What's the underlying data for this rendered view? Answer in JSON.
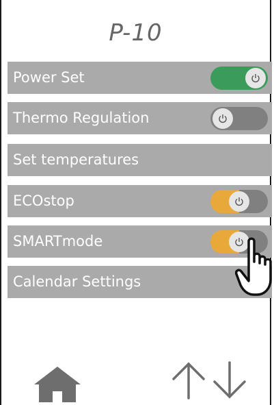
{
  "header": {
    "title": "P-10"
  },
  "menu": {
    "items": [
      {
        "label": "Power Set",
        "toggle": "on",
        "toggle_color": "#3a9b5a"
      },
      {
        "label": "Thermo Regulation",
        "toggle": "off"
      },
      {
        "label": "Set temperatures"
      },
      {
        "label": "ECOstop",
        "toggle": "on",
        "toggle_color": "#e9a93a"
      },
      {
        "label": "SMARTmode",
        "toggle": "on",
        "toggle_color": "#e9a93a"
      },
      {
        "label": "Calendar Settings"
      }
    ]
  },
  "footer": {
    "home_icon": "home-icon",
    "updown_icon": "arrows-updown-icon"
  },
  "colors": {
    "row_bg": "#aaaaaa",
    "row_text": "#ffffff",
    "toggle_off": "#808080"
  }
}
